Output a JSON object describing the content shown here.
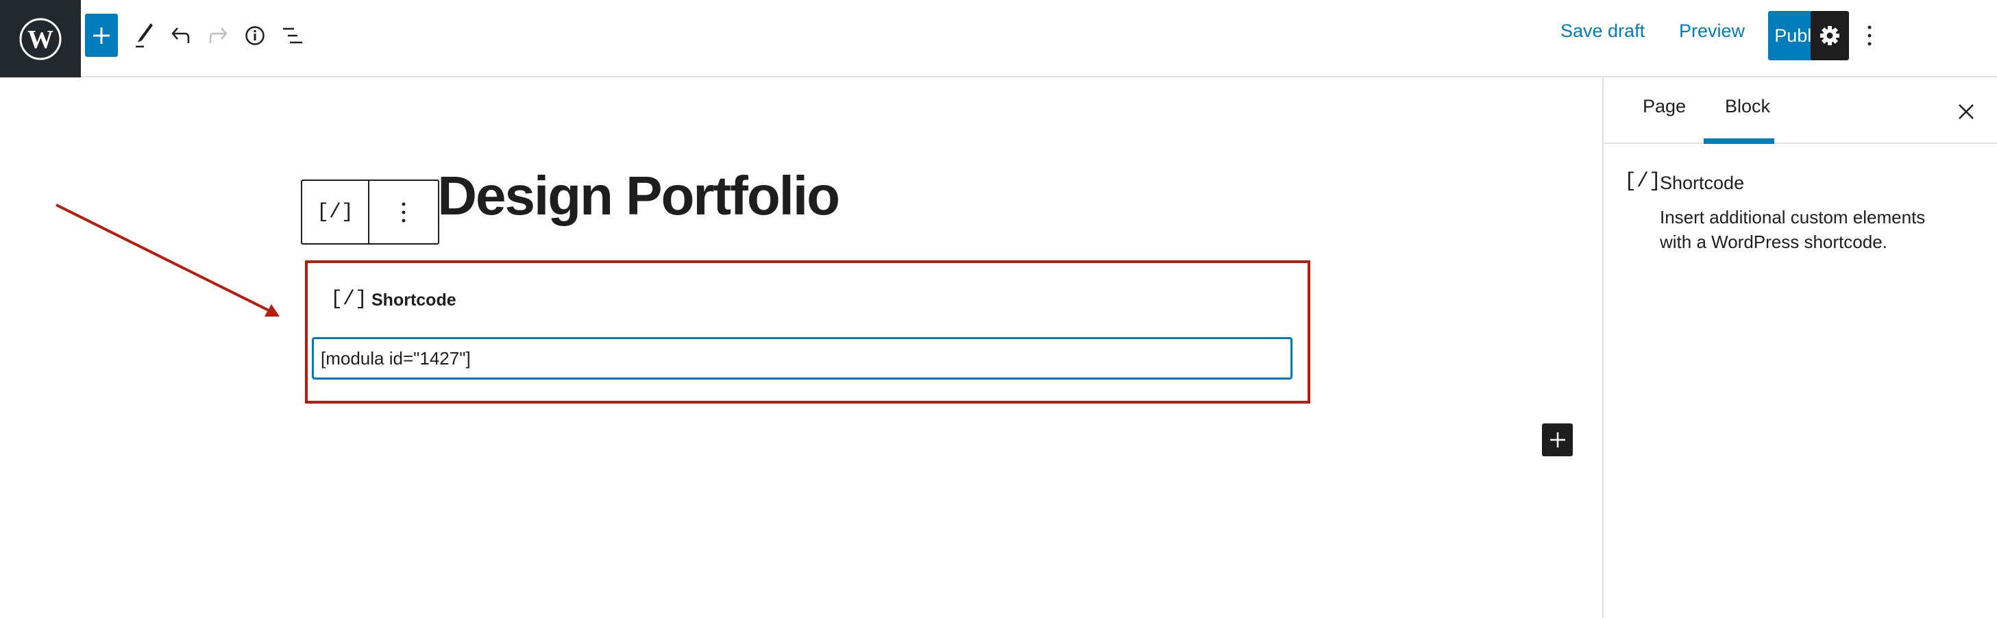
{
  "header": {
    "save_draft": "Save draft",
    "preview": "Preview",
    "publish": "Publish",
    "icons": [
      "wordpress-logo",
      "plus",
      "pencil",
      "undo",
      "redo",
      "info",
      "list-view",
      "gear",
      "kebab"
    ]
  },
  "editor": {
    "title": "or Design Portfolio",
    "block_label": "Shortcode",
    "shortcode_value": "[modula id=\"1427\"]",
    "annotation_color": "#b81c0c"
  },
  "sidebar": {
    "tabs": [
      {
        "label": "Page",
        "active": false
      },
      {
        "label": "Block",
        "active": true
      }
    ],
    "block_name": "Shortcode",
    "block_description_1": "Insert additional custom elements",
    "block_description_2": "with a WordPress shortcode."
  },
  "colors": {
    "accent": "#007cba",
    "dark": "#1e1e1e",
    "logo_bg": "#23282d"
  }
}
